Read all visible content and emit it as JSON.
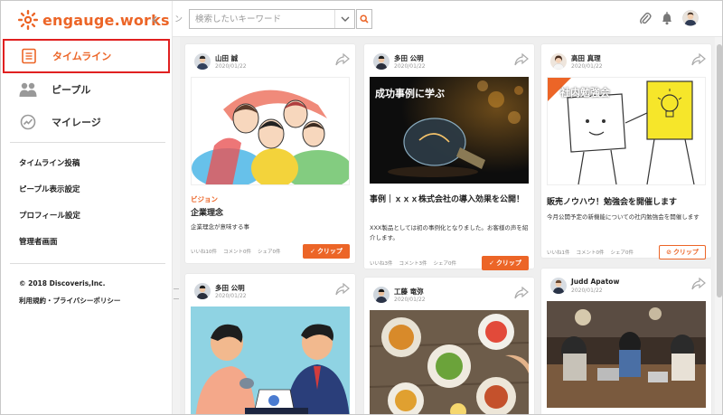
{
  "brand": {
    "name": "engauge.works",
    "color": "#ec6527"
  },
  "sidebar": {
    "nav": [
      {
        "label": "タイムライン",
        "icon": "timeline-icon",
        "active": true
      },
      {
        "label": "ピープル",
        "icon": "people-icon",
        "active": false
      },
      {
        "label": "マイレージ",
        "icon": "mileage-icon",
        "active": false
      }
    ],
    "links": [
      "タイムライン投稿",
      "ピープル表示設定",
      "プロフィール設定",
      "管理者画面"
    ],
    "copyright": "© 2018 Discoveris,Inc.",
    "terms": "利用規約・プライバシーポリシー"
  },
  "header": {
    "cut_text": "ン",
    "search_placeholder": "検索したいキーワード"
  },
  "cards": [
    {
      "author": "山田 誠",
      "date": "2020/01/22",
      "image": "people-hug-illustration",
      "tag": "ビジョン",
      "title": "企業理念",
      "desc": "企業理念が意味する事",
      "likes": "いいね10件",
      "comments": "コメント0件",
      "shares": "シェア0件",
      "clip": "クリップ",
      "clipped": true
    },
    {
      "author": "多田 公明",
      "date": "2020/01/22",
      "image": "light-bulb-photo",
      "image_text": "成功事例に学ぶ",
      "tag": "",
      "title": "事例｜ｘｘｘ株式会社の導入効果を公開！",
      "desc": "XXX製品としては初の事例化となりました。お客様の声を紹介します。",
      "likes": "いいね3件",
      "comments": "コメント3件",
      "shares": "シェア0件",
      "clip": "クリップ",
      "clipped": true
    },
    {
      "author": "高田 真理",
      "date": "2020/01/22",
      "image": "study-meeting-illustration",
      "image_text": "社内勉強会",
      "tag": "",
      "title": "販売ノウハウ！勉強会を開催します",
      "desc": "今月公開予定の新機能についての社内勉強会を開催します",
      "likes": "いいね1件",
      "comments": "コメント0件",
      "shares": "シェア0件",
      "clip": "クリップ",
      "clipped": false
    },
    {
      "author": "多田 公明",
      "date": "2020/01/22",
      "image": "business-meeting-illustration"
    },
    {
      "author": "工藤 竜弥",
      "date": "2020/01/22",
      "image": "food-table-photo"
    },
    {
      "author": "Judd Apatow",
      "date": "2020/01/22",
      "image": "office-team-photo"
    }
  ]
}
